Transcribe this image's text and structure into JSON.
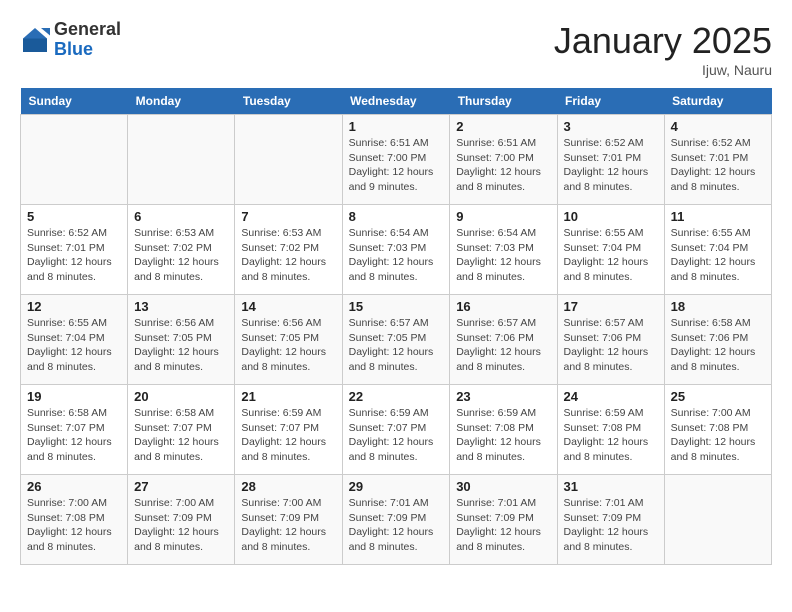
{
  "header": {
    "logo_general": "General",
    "logo_blue": "Blue",
    "month_title": "January 2025",
    "location": "Ijuw, Nauru"
  },
  "days_of_week": [
    "Sunday",
    "Monday",
    "Tuesday",
    "Wednesday",
    "Thursday",
    "Friday",
    "Saturday"
  ],
  "weeks": [
    [
      {
        "day": "",
        "info": ""
      },
      {
        "day": "",
        "info": ""
      },
      {
        "day": "",
        "info": ""
      },
      {
        "day": "1",
        "info": "Sunrise: 6:51 AM\nSunset: 7:00 PM\nDaylight: 12 hours and 9 minutes."
      },
      {
        "day": "2",
        "info": "Sunrise: 6:51 AM\nSunset: 7:00 PM\nDaylight: 12 hours and 8 minutes."
      },
      {
        "day": "3",
        "info": "Sunrise: 6:52 AM\nSunset: 7:01 PM\nDaylight: 12 hours and 8 minutes."
      },
      {
        "day": "4",
        "info": "Sunrise: 6:52 AM\nSunset: 7:01 PM\nDaylight: 12 hours and 8 minutes."
      }
    ],
    [
      {
        "day": "5",
        "info": "Sunrise: 6:52 AM\nSunset: 7:01 PM\nDaylight: 12 hours and 8 minutes."
      },
      {
        "day": "6",
        "info": "Sunrise: 6:53 AM\nSunset: 7:02 PM\nDaylight: 12 hours and 8 minutes."
      },
      {
        "day": "7",
        "info": "Sunrise: 6:53 AM\nSunset: 7:02 PM\nDaylight: 12 hours and 8 minutes."
      },
      {
        "day": "8",
        "info": "Sunrise: 6:54 AM\nSunset: 7:03 PM\nDaylight: 12 hours and 8 minutes."
      },
      {
        "day": "9",
        "info": "Sunrise: 6:54 AM\nSunset: 7:03 PM\nDaylight: 12 hours and 8 minutes."
      },
      {
        "day": "10",
        "info": "Sunrise: 6:55 AM\nSunset: 7:04 PM\nDaylight: 12 hours and 8 minutes."
      },
      {
        "day": "11",
        "info": "Sunrise: 6:55 AM\nSunset: 7:04 PM\nDaylight: 12 hours and 8 minutes."
      }
    ],
    [
      {
        "day": "12",
        "info": "Sunrise: 6:55 AM\nSunset: 7:04 PM\nDaylight: 12 hours and 8 minutes."
      },
      {
        "day": "13",
        "info": "Sunrise: 6:56 AM\nSunset: 7:05 PM\nDaylight: 12 hours and 8 minutes."
      },
      {
        "day": "14",
        "info": "Sunrise: 6:56 AM\nSunset: 7:05 PM\nDaylight: 12 hours and 8 minutes."
      },
      {
        "day": "15",
        "info": "Sunrise: 6:57 AM\nSunset: 7:05 PM\nDaylight: 12 hours and 8 minutes."
      },
      {
        "day": "16",
        "info": "Sunrise: 6:57 AM\nSunset: 7:06 PM\nDaylight: 12 hours and 8 minutes."
      },
      {
        "day": "17",
        "info": "Sunrise: 6:57 AM\nSunset: 7:06 PM\nDaylight: 12 hours and 8 minutes."
      },
      {
        "day": "18",
        "info": "Sunrise: 6:58 AM\nSunset: 7:06 PM\nDaylight: 12 hours and 8 minutes."
      }
    ],
    [
      {
        "day": "19",
        "info": "Sunrise: 6:58 AM\nSunset: 7:07 PM\nDaylight: 12 hours and 8 minutes."
      },
      {
        "day": "20",
        "info": "Sunrise: 6:58 AM\nSunset: 7:07 PM\nDaylight: 12 hours and 8 minutes."
      },
      {
        "day": "21",
        "info": "Sunrise: 6:59 AM\nSunset: 7:07 PM\nDaylight: 12 hours and 8 minutes."
      },
      {
        "day": "22",
        "info": "Sunrise: 6:59 AM\nSunset: 7:07 PM\nDaylight: 12 hours and 8 minutes."
      },
      {
        "day": "23",
        "info": "Sunrise: 6:59 AM\nSunset: 7:08 PM\nDaylight: 12 hours and 8 minutes."
      },
      {
        "day": "24",
        "info": "Sunrise: 6:59 AM\nSunset: 7:08 PM\nDaylight: 12 hours and 8 minutes."
      },
      {
        "day": "25",
        "info": "Sunrise: 7:00 AM\nSunset: 7:08 PM\nDaylight: 12 hours and 8 minutes."
      }
    ],
    [
      {
        "day": "26",
        "info": "Sunrise: 7:00 AM\nSunset: 7:08 PM\nDaylight: 12 hours and 8 minutes."
      },
      {
        "day": "27",
        "info": "Sunrise: 7:00 AM\nSunset: 7:09 PM\nDaylight: 12 hours and 8 minutes."
      },
      {
        "day": "28",
        "info": "Sunrise: 7:00 AM\nSunset: 7:09 PM\nDaylight: 12 hours and 8 minutes."
      },
      {
        "day": "29",
        "info": "Sunrise: 7:01 AM\nSunset: 7:09 PM\nDaylight: 12 hours and 8 minutes."
      },
      {
        "day": "30",
        "info": "Sunrise: 7:01 AM\nSunset: 7:09 PM\nDaylight: 12 hours and 8 minutes."
      },
      {
        "day": "31",
        "info": "Sunrise: 7:01 AM\nSunset: 7:09 PM\nDaylight: 12 hours and 8 minutes."
      },
      {
        "day": "",
        "info": ""
      }
    ]
  ]
}
